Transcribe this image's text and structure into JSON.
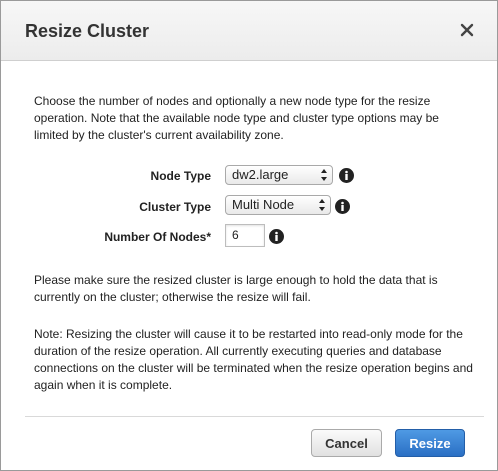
{
  "dialog": {
    "title": "Resize Cluster",
    "intro": "Choose the number of nodes and optionally a new node type for the resize operation. Note that the available node type and cluster type options may be limited by the cluster's current availability zone.",
    "warning": "Please make sure the resized cluster is large enough to hold the data that is currently on the cluster; otherwise the resize will fail.",
    "note": "Note: Resizing the cluster will cause it to be restarted into read-only mode for the duration of the resize operation. All currently executing queries and database connections on the cluster will be terminated when the resize operation begins and again when it is complete."
  },
  "form": {
    "node_type": {
      "label": "Node Type",
      "value": "dw2.large"
    },
    "cluster_type": {
      "label": "Cluster Type",
      "value": "Multi Node"
    },
    "number_of_nodes": {
      "label": "Number Of Nodes*",
      "value": "6"
    }
  },
  "footer": {
    "cancel_label": "Cancel",
    "resize_label": "Resize"
  },
  "colors": {
    "primary_button": "#2f78cc",
    "header_bg": "#f2f2f2"
  },
  "icons": {
    "close": "close-icon",
    "info": "info-icon",
    "select_arrows": "updown-arrows-icon"
  }
}
